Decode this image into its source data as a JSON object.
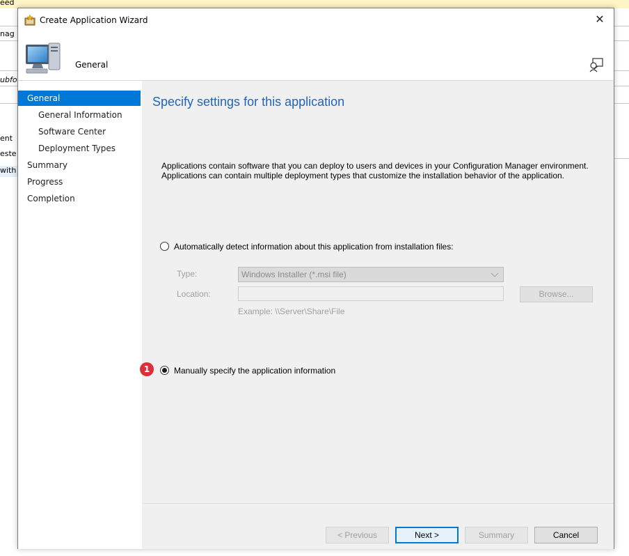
{
  "background": {
    "banner_text": "eed",
    "fragments": [
      "nag",
      "ubfo",
      "ent",
      "este",
      "with"
    ]
  },
  "dialog": {
    "title": "Create Application Wizard",
    "close_glyph": "✕",
    "header_title": "General"
  },
  "sidebar": {
    "items": [
      {
        "label": "General",
        "active": true
      },
      {
        "label": "General Information"
      },
      {
        "label": "Software Center"
      },
      {
        "label": "Deployment Types"
      },
      {
        "label": "Summary"
      },
      {
        "label": "Progress"
      },
      {
        "label": "Completion"
      }
    ]
  },
  "main": {
    "heading": "Specify settings for this application",
    "description_line1": "Applications contain software that you can deploy to users and devices in your Configuration Manager environment.",
    "description_line2": "Applications can contain multiple deployment types that customize the installation behavior of the application.",
    "auto_detect_label": "Automatically detect information about this application from installation files:",
    "auto_detect_selected": false,
    "type_label": "Type:",
    "type_value": "Windows Installer (*.msi file)",
    "location_label": "Location:",
    "location_value": "",
    "browse_label": "Browse...",
    "example_text": "Example: \\\\Server\\Share\\File",
    "manual_label": "Manually specify the application information",
    "manual_selected": true,
    "step_badge": "1"
  },
  "footer": {
    "previous_label": "< Previous",
    "next_label": "Next >",
    "summary_label": "Summary",
    "cancel_label": "Cancel"
  },
  "colors": {
    "accent": "#0078d7",
    "heading": "#2065b6",
    "badge": "#d9303a"
  }
}
